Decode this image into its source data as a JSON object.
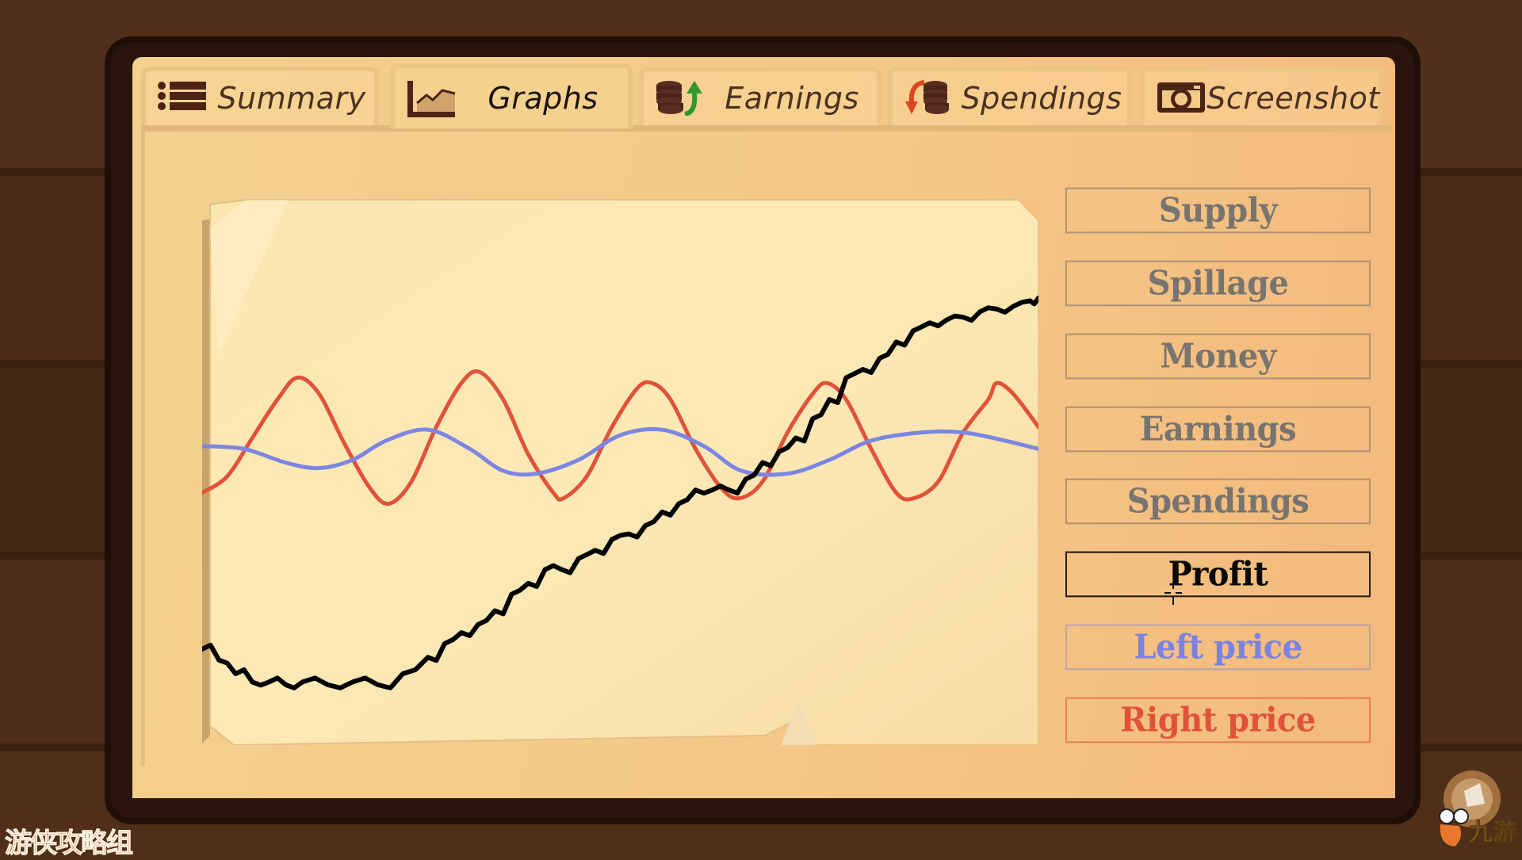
{
  "tabs": [
    {
      "label": "Summary",
      "icon": "list-icon",
      "active": false
    },
    {
      "label": "Graphs",
      "icon": "line-chart-icon",
      "active": true
    },
    {
      "label": "Earnings",
      "icon": "coins-up-icon",
      "active": false
    },
    {
      "label": "Spendings",
      "icon": "coins-down-icon",
      "active": false
    },
    {
      "label": "Screenshot",
      "icon": "camera-icon",
      "active": false
    }
  ],
  "graph_buttons": [
    {
      "label": "Supply",
      "state": "inactive"
    },
    {
      "label": "Spillage",
      "state": "inactive"
    },
    {
      "label": "Money",
      "state": "inactive"
    },
    {
      "label": "Earnings",
      "state": "inactive"
    },
    {
      "label": "Spendings",
      "state": "inactive"
    },
    {
      "label": "Profit",
      "state": "selected"
    },
    {
      "label": "Left price",
      "state": "shown"
    },
    {
      "label": "Right price",
      "state": "shown"
    }
  ],
  "colors": {
    "profit": "#000000",
    "left_price": "#7b86e2",
    "right_price": "#e0523a",
    "panel": "#f4c887",
    "frame": "#2a140b",
    "background": "#4f2f18"
  },
  "watermarks": {
    "left": "游侠攻略组",
    "right": "九游"
  },
  "chart_data": {
    "type": "line",
    "title": "",
    "xlabel": "",
    "ylabel": "",
    "grid": false,
    "xlim": [
      0,
      1
    ],
    "ylim": [
      0,
      100
    ],
    "series": [
      {
        "name": "Right price",
        "color": "#e0523a",
        "x": [
          0,
          0.03,
          0.06,
          0.09,
          0.114,
          0.14,
          0.17,
          0.2,
          0.223,
          0.25,
          0.28,
          0.31,
          0.332,
          0.36,
          0.39,
          0.42,
          0.432,
          0.46,
          0.49,
          0.52,
          0.538,
          0.56,
          0.59,
          0.62,
          0.642,
          0.67,
          0.7,
          0.73,
          0.747,
          0.77,
          0.8,
          0.83,
          0.851,
          0.88,
          0.91,
          0.94,
          0.95,
          0.97,
          1.0
        ],
        "values": [
          46,
          49,
          56,
          63,
          67,
          64,
          55,
          47,
          44,
          48,
          58,
          66,
          68,
          63,
          53,
          46,
          45,
          49,
          58,
          65,
          66,
          63,
          54,
          47,
          45,
          48,
          57,
          64,
          66,
          63,
          54,
          46,
          45,
          48,
          57,
          63,
          66,
          64,
          58
        ]
      },
      {
        "name": "Left price",
        "color": "#7b86e2",
        "x": [
          0,
          0.05,
          0.1,
          0.14,
          0.18,
          0.22,
          0.27,
          0.32,
          0.36,
          0.4,
          0.45,
          0.5,
          0.55,
          0.6,
          0.645,
          0.7,
          0.75,
          0.8,
          0.86,
          0.91,
          0.96,
          1.0
        ],
        "values": [
          54.5,
          54,
          51.5,
          50.5,
          52,
          55.5,
          57.5,
          54,
          50,
          49.5,
          52,
          56.5,
          57.5,
          54.5,
          50,
          49.5,
          52,
          55.5,
          57,
          57,
          55.5,
          54
        ]
      },
      {
        "name": "Profit",
        "color": "#000000",
        "x": [
          0,
          0.02,
          0.04,
          0.06,
          0.08,
          0.1,
          0.12,
          0.15,
          0.18,
          0.21,
          0.24,
          0.27,
          0.29,
          0.31,
          0.33,
          0.35,
          0.37,
          0.39,
          0.41,
          0.43,
          0.45,
          0.47,
          0.49,
          0.51,
          0.53,
          0.55,
          0.57,
          0.59,
          0.61,
          0.63,
          0.65,
          0.67,
          0.69,
          0.71,
          0.73,
          0.75,
          0.77,
          0.79,
          0.81,
          0.83,
          0.85,
          0.87,
          0.89,
          0.91,
          0.93,
          0.95,
          0.97,
          0.99,
          1.0
        ],
        "values": [
          17.5,
          15.5,
          13,
          11.5,
          11.5,
          11,
          11.5,
          11,
          11.5,
          11,
          13,
          16,
          18.5,
          20.5,
          22,
          24.5,
          27.5,
          29.5,
          32,
          32,
          34,
          35.5,
          37.5,
          38.5,
          40,
          42.5,
          44,
          46.5,
          46.5,
          46.5,
          48.5,
          51.5,
          53.5,
          56,
          59.5,
          63,
          67,
          68.5,
          70.5,
          73.5,
          75.5,
          77,
          77.5,
          78,
          79,
          79.5,
          80,
          81,
          81.5
        ]
      }
    ]
  }
}
